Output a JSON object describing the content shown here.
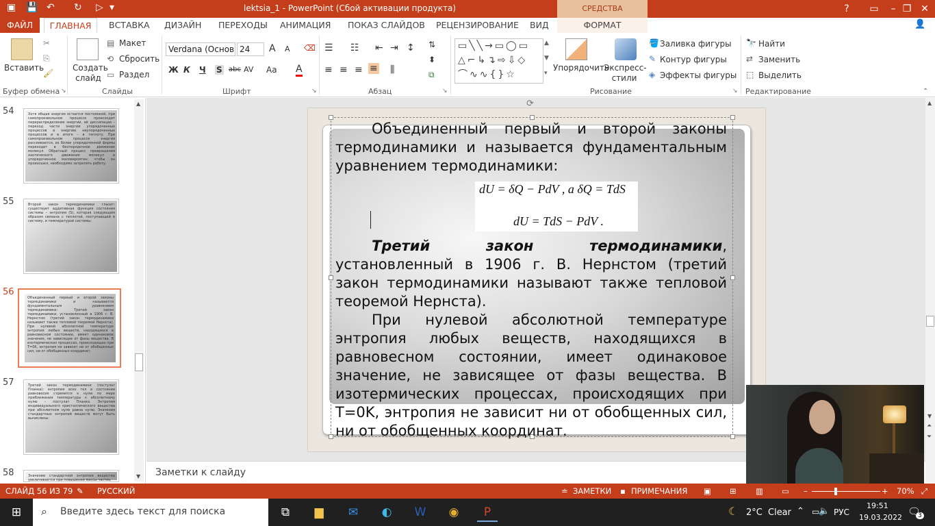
{
  "window": {
    "title": "lektsia_1 - PowerPoint (Сбой активации продукта)",
    "contextual_tab": "СРЕДСТВА РИСОВАНИЯ",
    "help": "?",
    "minimize": "–",
    "restore": "❐",
    "close": "✕"
  },
  "tabs": [
    "ФАЙЛ",
    "ГЛАВНАЯ",
    "ВСТАВКА",
    "ДИЗАЙН",
    "ПЕРЕХОДЫ",
    "АНИМАЦИЯ",
    "ПОКАЗ СЛАЙДОВ",
    "РЕЦЕНЗИРОВАНИЕ",
    "ВИД",
    "ФОРМАТ"
  ],
  "ribbon": {
    "clipboard": {
      "paste": "Вставить",
      "group": "Буфер обмена"
    },
    "slides": {
      "new_slide": "Создать слайд",
      "layout": "Макет",
      "reset": "Сбросить",
      "section": "Раздел",
      "group": "Слайды"
    },
    "font": {
      "font_name": "Verdana (Основ",
      "font_size": "24",
      "bold": "Ж",
      "italic": "К",
      "underline": "Ч",
      "shadow": "S",
      "strike": "abc",
      "spacing": "AV",
      "case": "Aa",
      "color": "A",
      "grow": "A",
      "shrink": "A",
      "group": "Шрифт"
    },
    "paragraph": {
      "group": "Абзац"
    },
    "drawing": {
      "arrange": "Упорядочить",
      "quick_styles": "Экспресс-стили",
      "fill": "Заливка фигуры",
      "outline": "Контур фигуры",
      "effects": "Эффекты фигуры",
      "group": "Рисование"
    },
    "editing": {
      "find": "Найти",
      "replace": "Заменить",
      "select": "Выделить",
      "group": "Редактирование"
    }
  },
  "thumbnails": [
    {
      "num": "54",
      "text": "Хотя общая энергия остается постоянной, при самопроизвольном процессе происходит перераспределение энергии, её диссипация – переход части энергии упорядоченных процессов в энергию неупорядоченных процессов и в итоге – в теплоту. При самопроизвольном процессе энергия рассеивается, из более упорядоченной формы переходит в беспорядочное движение молекул. Обратный процесс превращения хаотического движения молекул в упорядоченное маловероятен; чтобы он произошел, необходимо затратить работу."
    },
    {
      "num": "55",
      "text": "Второй закон термодинамики гласит: существует аддитивная функция состояния системы – энтропия (S), которая следующим образом связана с теплотой, поступающей в систему, и температурой системы:"
    },
    {
      "num": "56",
      "text": "Объединенный первый и второй законы термодинамики и называется фундаментальным уравнением термодинамики: Третий закон термодинамики, установленный в 1906 г. В. Нернстом (третий закон термодинамики называют также тепловой теоремой Нернста). При нулевой абсолютной температуре энтропия любых веществ, находящихся в равновесном состоянии, имеет одинаковое значение, не зависящее от фазы вещества. В изотермических процессах, происходящих при T=0K, энтропия не зависит ни от обобщенных сил, ни от обобщенных координат."
    },
    {
      "num": "57",
      "text": "Третий закон термодинамики (постулат Планка): энтропия всех тел в состоянии равновесия стремится к нулю по мере приближения температуры к абсолютному нулю – постулат Планка. Энтропия индивидуального кристаллического вещества при абсолютном нуле равна нулю. Значения стандартных энтропий веществ могут быть вычислены:"
    },
    {
      "num": "58",
      "text": "Значение стандартной энтропии вещества увеличивается при повышении массы частиц"
    }
  ],
  "slide": {
    "p1": "Объединенный первый и второй законы термодинамики и называется фундаментальным уравнением термодинамики:",
    "formula1": "dU = δQ − PdV ,  а  δQ = TdS",
    "formula2": "dU = TdS − PdV .",
    "p2_bold": "Третий закон термодинамики",
    "p2_rest": ", установленный в 1906 г. В. Нернстом (третий закон термодинамики называют также тепловой теоремой Нернста).",
    "p3": "При нулевой абсолютной температуре энтропия любых веществ, находящихся в равновесном состоянии, имеет одинаковое значение, не зависящее от фазы вещества. В изотермических процессах, происходящих при T=0K, энтропия не зависит ни от обобщенных сил, ни от обобщенных координат."
  },
  "notes": {
    "placeholder": "Заметки к слайду"
  },
  "status": {
    "slide_info": "СЛАЙД 56 ИЗ 79",
    "language": "РУССКИЙ",
    "notes": "ЗАМЕТКИ",
    "comments": "ПРИМЕЧАНИЯ",
    "zoom": "70%",
    "zoom_minus": "–",
    "zoom_plus": "+",
    "zoom_level": 0.35
  },
  "taskbar": {
    "search_placeholder": "Введите здесь текст для поиска",
    "weather_temp": "2°C",
    "weather_text": "Clear",
    "lang": "РУС",
    "time": "19:51",
    "date": "19.03.2022",
    "notifications": "3"
  }
}
